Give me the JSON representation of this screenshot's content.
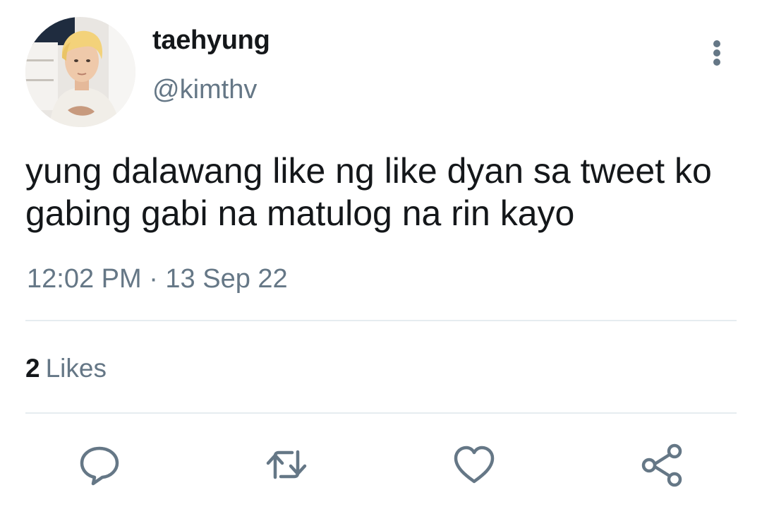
{
  "tweet": {
    "author": {
      "display_name": "taehyung",
      "handle": "@kimthv"
    },
    "text": "yung dalawang like ng like dyan sa tweet ko gabing gabi na matulog na rin kayo",
    "timestamp": "12:02 PM · 13 Sep 22",
    "likes": {
      "count": "2",
      "label": "Likes"
    }
  },
  "icons": {
    "more": "more-vertical-icon",
    "reply": "reply-icon",
    "retweet": "retweet-icon",
    "like": "heart-icon",
    "share": "share-icon"
  },
  "colors": {
    "text_primary": "#14171a",
    "text_secondary": "#657786",
    "divider": "#e6ecf0",
    "icon": "#657786"
  }
}
